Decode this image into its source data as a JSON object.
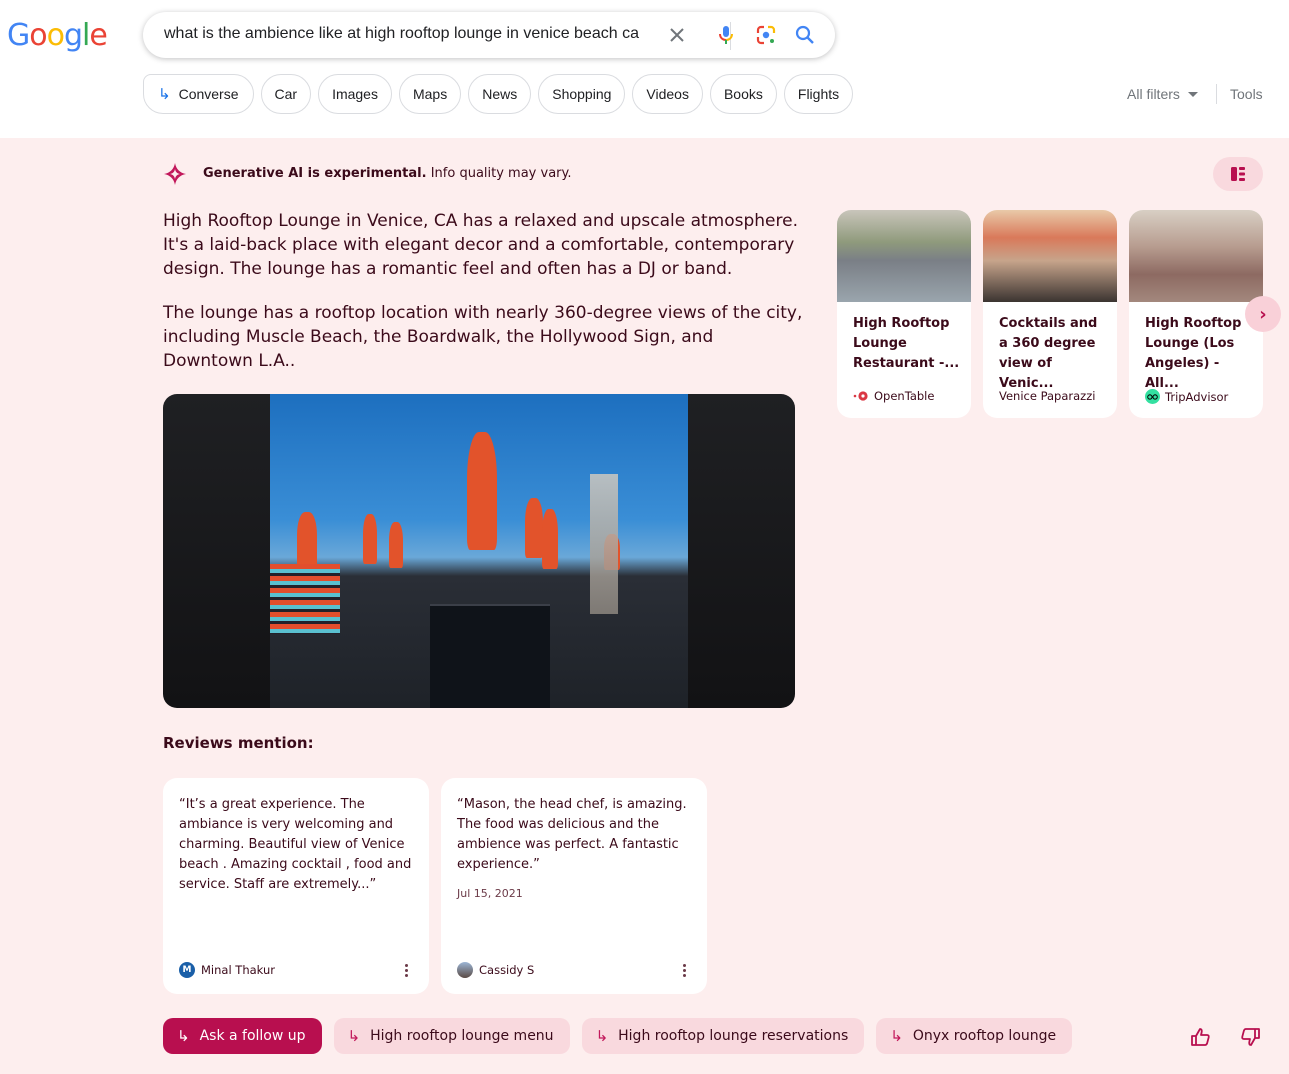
{
  "logo": {
    "text": "Google",
    "letters": [
      {
        "ch": "G",
        "color": "#4285f4"
      },
      {
        "ch": "o",
        "color": "#ea4335"
      },
      {
        "ch": "o",
        "color": "#fbbc05"
      },
      {
        "ch": "g",
        "color": "#4285f4"
      },
      {
        "ch": "l",
        "color": "#34a853"
      },
      {
        "ch": "e",
        "color": "#ea4335"
      }
    ]
  },
  "search": {
    "query": "what is the ambience like at high rooftop lounge in venice beach ca",
    "icons": [
      "clear-icon",
      "microphone-icon",
      "google-lens-icon",
      "search-icon"
    ]
  },
  "chips": [
    {
      "label": "Converse",
      "icon": "arrow-return-icon"
    },
    {
      "label": "Car"
    },
    {
      "label": "Images"
    },
    {
      "label": "Maps"
    },
    {
      "label": "News"
    },
    {
      "label": "Shopping"
    },
    {
      "label": "Videos"
    },
    {
      "label": "Books"
    },
    {
      "label": "Flights"
    }
  ],
  "filters": {
    "all_filters": "All filters",
    "tools": "Tools"
  },
  "sge": {
    "accent": "#b80f4f",
    "notice_bold": "Generative AI is experimental.",
    "notice_rest": " Info quality may vary.",
    "paragraphs": [
      "High Rooftop Lounge in Venice, CA has a relaxed and upscale atmosphere. It's a laid-back place with elegant decor and a comfortable, contemporary design. The lounge has a romantic feel and often has a DJ or band.",
      "The lounge has a rooftop location with nearly 360-degree views of the city, including Muscle Beach, the Boardwalk, the Hollywood Sign, and Downtown L.A.."
    ],
    "sources": [
      {
        "title": "High Rooftop Lounge Restaurant -...",
        "site": "OpenTable",
        "site_icon": "opentable-icon"
      },
      {
        "title": "Cocktails and a 360 degree view of Venic...",
        "site": "Venice Paparazzi",
        "site_icon": ""
      },
      {
        "title": "High Rooftop Lounge (Los Angeles) - All...",
        "site": "TripAdvisor",
        "site_icon": "tripadvisor-icon"
      }
    ],
    "reviews_title": "Reviews mention:",
    "reviews": [
      {
        "quote": "“It’s a great experience. The ambiance is very welcoming and charming. Beautiful view of Venice beach . Amazing cocktail , food and service. Staff are extremely...”",
        "date": "",
        "author": "Minal Thakur",
        "avatar_initial": "M"
      },
      {
        "quote": "“Mason, the head chef, is amazing. The food was delicious and the ambience was perfect. A fantastic experience.”",
        "date": "Jul 15, 2021",
        "author": "Cassidy S",
        "avatar_initial": ""
      }
    ],
    "followups": [
      {
        "label": "Ask a follow up",
        "primary": true
      },
      {
        "label": "High rooftop lounge menu"
      },
      {
        "label": "High rooftop lounge reservations"
      },
      {
        "label": "Onyx rooftop lounge"
      }
    ]
  }
}
